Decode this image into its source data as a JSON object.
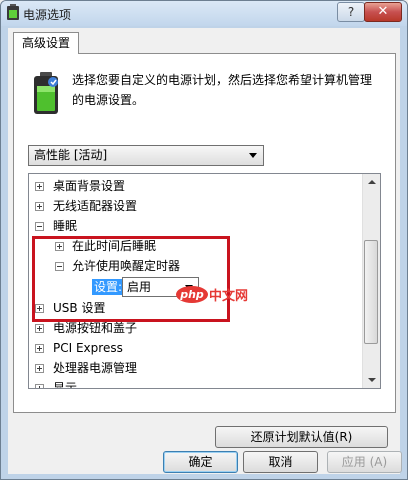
{
  "window": {
    "title": "电源选项",
    "help_label": "?",
    "close_label": "✕"
  },
  "tab": {
    "label": "高级设置"
  },
  "description": "选择您要自定义的电源计划，然后选择您希望计算机管理的电源设置。",
  "plan": {
    "selected": "高性能 [活动]"
  },
  "tree": {
    "items": [
      {
        "label": "桌面背景设置"
      },
      {
        "label": "无线适配器设置"
      },
      {
        "label": "睡眠"
      },
      {
        "label": "在此时间后睡眠"
      },
      {
        "label": "允许使用唤醒定时器"
      },
      {
        "label": "USB 设置"
      },
      {
        "label": "电源按钮和盖子"
      },
      {
        "label": "PCI Express"
      },
      {
        "label": "处理器电源管理"
      },
      {
        "label": "显示"
      }
    ],
    "setting_label": "设置:",
    "setting_value": "启用"
  },
  "watermark": {
    "logo": "php",
    "text": "中文网"
  },
  "buttons": {
    "restore": "还原计划默认值(R)",
    "ok": "确定",
    "cancel": "取消",
    "apply": "应用 (A)"
  },
  "colors": {
    "highlight_border": "#c9131e",
    "selection": "#3399ff",
    "watermark": "#e53935"
  }
}
